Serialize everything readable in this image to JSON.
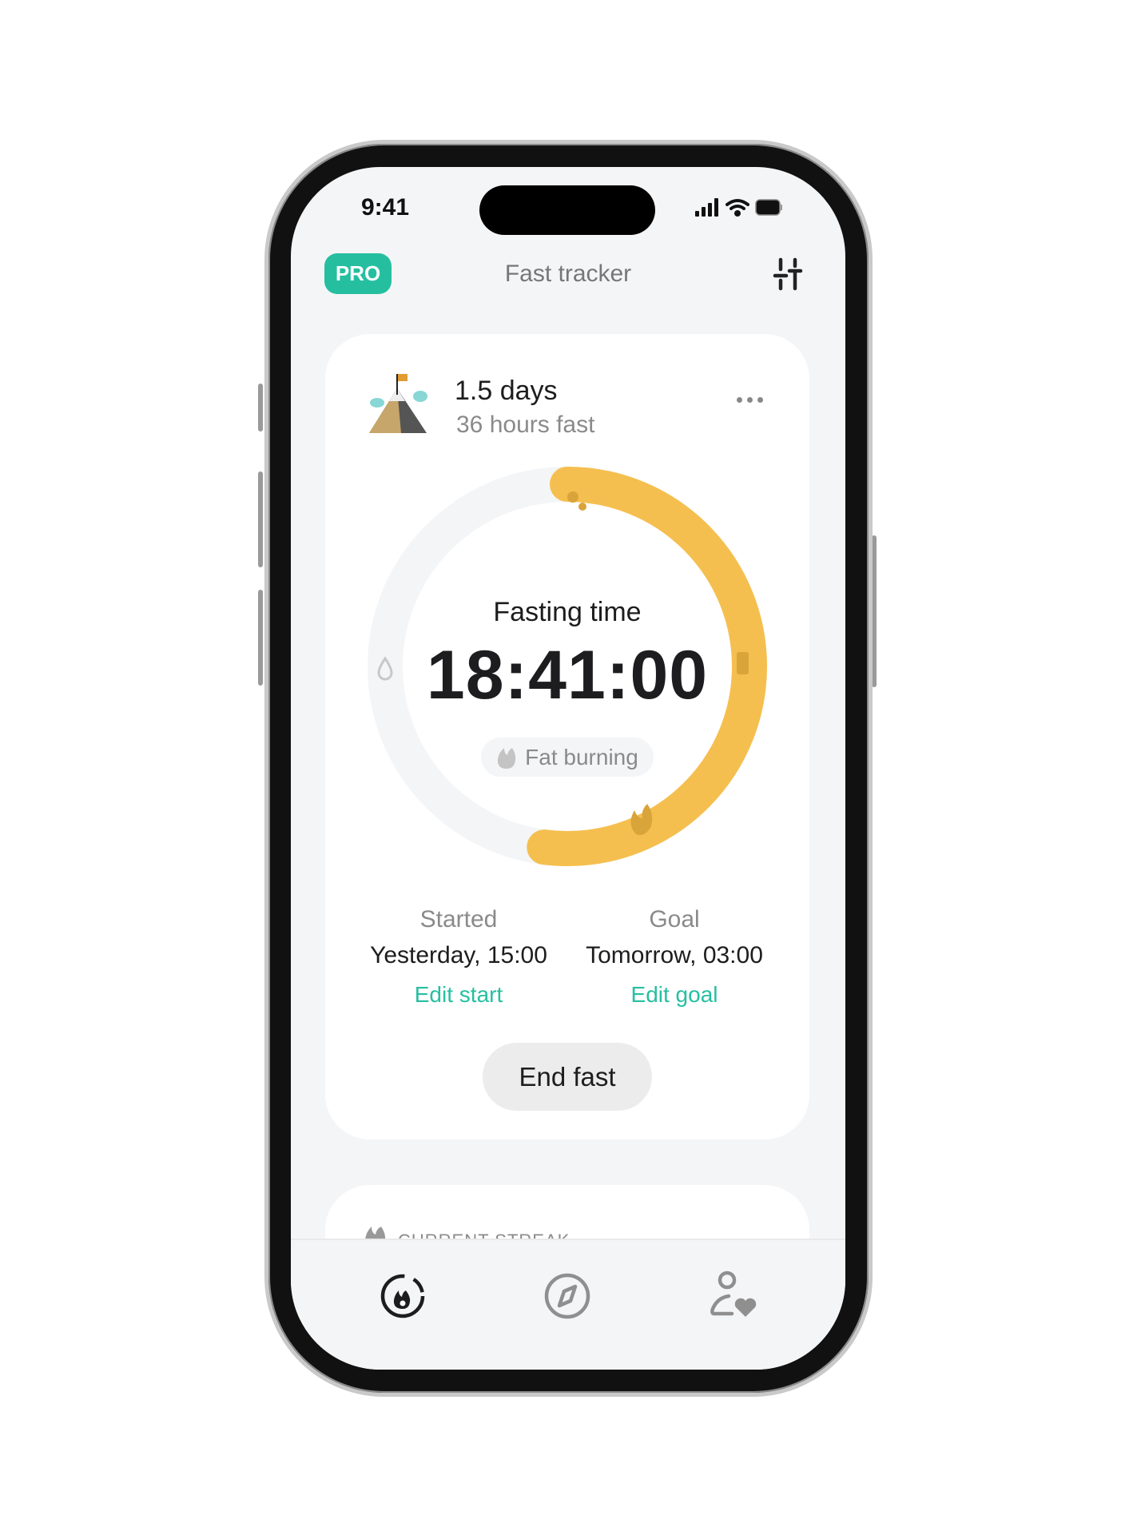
{
  "status_bar": {
    "time": "9:41"
  },
  "header": {
    "pro_badge": "PRO",
    "title": "Fast tracker",
    "settings_icon": "sliders-icon"
  },
  "fast_card": {
    "duration_title": "1.5 days",
    "duration_subtitle": "36 hours fast",
    "more_icon": "more-horizontal-icon",
    "progress_fraction": 0.52,
    "progress_color": "#f5bf4f",
    "track_color": "#f4f5f7",
    "timer_label": "Fasting time",
    "timer_value": "18:41:00",
    "stage_label": "Fat burning",
    "started_label": "Started",
    "started_value": "Yesterday, 15:00",
    "edit_start": "Edit start",
    "goal_label": "Goal",
    "goal_value": "Tomorrow, 03:00",
    "edit_goal": "Edit goal",
    "end_button": "End fast",
    "accent_color": "#25bfa0"
  },
  "streak_card": {
    "title": "CURRENT STREAK"
  },
  "tab_bar": {
    "items": [
      {
        "icon": "fasting-flame-icon",
        "active": true
      },
      {
        "icon": "compass-icon",
        "active": false
      },
      {
        "icon": "profile-heart-icon",
        "active": false
      }
    ]
  }
}
